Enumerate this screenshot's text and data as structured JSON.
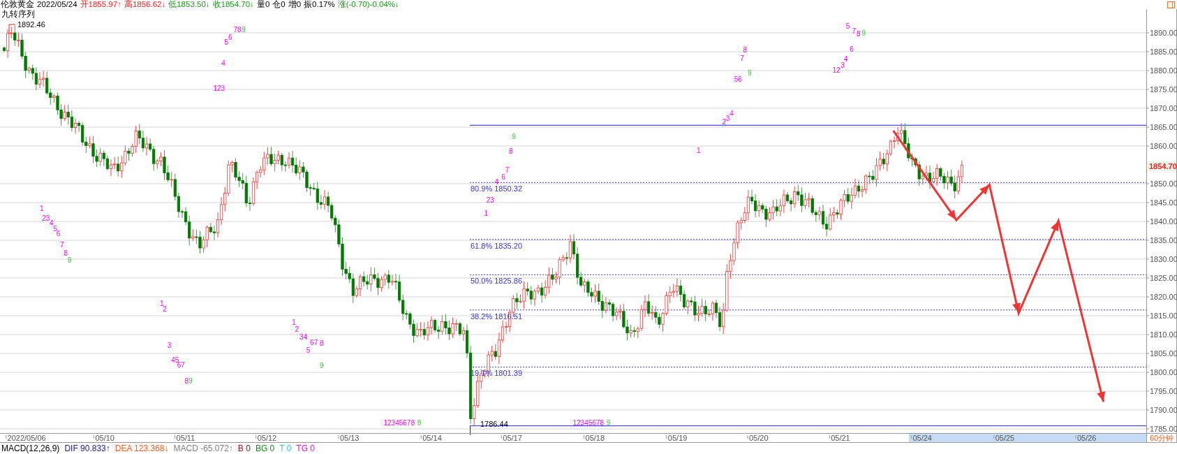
{
  "quote_bar": {
    "items": [
      {
        "text": "伦敦黄金",
        "kind": "flat"
      },
      {
        "text": "2022/05/24",
        "kind": "flat"
      },
      {
        "text": "开1855.97↑",
        "kind": "up"
      },
      {
        "text": "高1856.62↓",
        "kind": "up"
      },
      {
        "text": "低1853.50↓",
        "kind": "down"
      },
      {
        "text": "收1854.70↓",
        "kind": "down"
      },
      {
        "text": "量0",
        "kind": "flat"
      },
      {
        "text": "仓0",
        "kind": "flat"
      },
      {
        "text": "增0",
        "kind": "flat"
      },
      {
        "text": "振0.17%",
        "kind": "flat"
      },
      {
        "text": "涨(-0.70)-0.04%↓",
        "kind": "down"
      }
    ]
  },
  "chart": {
    "indicator_label": "九转序列",
    "high_label": "1892.46",
    "low_label": "1786.44",
    "price_ticks": [
      "1890.00",
      "1885.00",
      "1880.00",
      "1875.00",
      "1870.00",
      "1865.00",
      "1860.00",
      "1850.00",
      "1845.00",
      "1840.00",
      "1835.00",
      "1830.00",
      "1825.00",
      "1820.00",
      "1815.00",
      "1810.00",
      "1805.00",
      "1800.00",
      "1795.00",
      "1790.00",
      "1785.00"
    ],
    "last_price": "1854.70",
    "fib_levels": [
      {
        "label": "80.9% 1850.32"
      },
      {
        "label": "61.8% 1835.20"
      },
      {
        "label": "50.0% 1825.86"
      },
      {
        "label": "38.2% 1816.51"
      },
      {
        "label": "19.1% 1801.39"
      }
    ],
    "td_marks": [
      {
        "text": "78",
        "kind": "count"
      },
      {
        "text": "9",
        "kind": "final"
      },
      {
        "text": "6",
        "kind": "count"
      },
      {
        "text": "5",
        "kind": "count"
      },
      {
        "text": "4",
        "kind": "count"
      },
      {
        "text": "123",
        "kind": "count"
      },
      {
        "text": "1",
        "kind": "count"
      },
      {
        "text": "23",
        "kind": "count"
      },
      {
        "text": "4",
        "kind": "count"
      },
      {
        "text": "5",
        "kind": "count"
      },
      {
        "text": "6",
        "kind": "count"
      },
      {
        "text": "7",
        "kind": "count"
      },
      {
        "text": "8",
        "kind": "count"
      },
      {
        "text": "9",
        "kind": "final"
      },
      {
        "text": "1",
        "kind": "count"
      },
      {
        "text": "2",
        "kind": "count"
      },
      {
        "text": "3",
        "kind": "count"
      },
      {
        "text": "45",
        "kind": "count"
      },
      {
        "text": "67",
        "kind": "count"
      },
      {
        "text": "8",
        "kind": "count"
      },
      {
        "text": "9",
        "kind": "final"
      },
      {
        "text": "1",
        "kind": "count"
      },
      {
        "text": "2",
        "kind": "count"
      },
      {
        "text": "34",
        "kind": "count"
      },
      {
        "text": "67",
        "kind": "count"
      },
      {
        "text": "8",
        "kind": "count"
      },
      {
        "text": "5",
        "kind": "count"
      },
      {
        "text": "9",
        "kind": "final"
      },
      {
        "text": "1",
        "kind": "count"
      },
      {
        "text": "23",
        "kind": "count"
      },
      {
        "text": "4",
        "kind": "count"
      },
      {
        "text": "6",
        "kind": "count"
      },
      {
        "text": "7",
        "kind": "count"
      },
      {
        "text": "8",
        "kind": "count"
      },
      {
        "text": "9",
        "kind": "final"
      },
      {
        "text": "1",
        "kind": "count"
      },
      {
        "text": "2",
        "kind": "count"
      },
      {
        "text": "3",
        "kind": "count"
      },
      {
        "text": "4",
        "kind": "count"
      },
      {
        "text": "56",
        "kind": "count"
      },
      {
        "text": "9",
        "kind": "final"
      },
      {
        "text": "7",
        "kind": "count"
      },
      {
        "text": "8",
        "kind": "count"
      },
      {
        "text": "12",
        "kind": "count"
      },
      {
        "text": "3",
        "kind": "count"
      },
      {
        "text": "4",
        "kind": "count"
      },
      {
        "text": "6",
        "kind": "count"
      },
      {
        "text": "5",
        "kind": "count"
      },
      {
        "text": "7",
        "kind": "count"
      },
      {
        "text": "8",
        "kind": "count"
      },
      {
        "text": "9",
        "kind": "final"
      },
      {
        "text": "12345678",
        "kind": "count"
      },
      {
        "text": "9",
        "kind": "final"
      },
      {
        "text": "12345678",
        "kind": "count"
      },
      {
        "text": "9",
        "kind": "final"
      }
    ],
    "date_ticks": [
      "2022/05/06",
      "05/10",
      "05/11",
      "05/12",
      "05/13",
      "05/14",
      "05/17",
      "05/18",
      "05/19",
      "05/20",
      "05/21",
      "05/24",
      "05/25",
      "05/26"
    ],
    "period": "60分钟"
  },
  "macd_bar": {
    "title": "MACD(12,26,9)",
    "items": [
      {
        "text": "DIF 90.833↑",
        "color": "#2020a0"
      },
      {
        "text": "DEA 123.368↓",
        "color": "#ff5a1e"
      },
      {
        "text": "MACD -65.072↑",
        "color": "#808080"
      },
      {
        "text": "B 0",
        "color": "#a01010"
      },
      {
        "text": "BG 0",
        "color": "#109010"
      },
      {
        "text": "T 0",
        "color": "#20d0e0"
      },
      {
        "text": "TG 0",
        "color": "#ff00ff"
      }
    ]
  }
}
